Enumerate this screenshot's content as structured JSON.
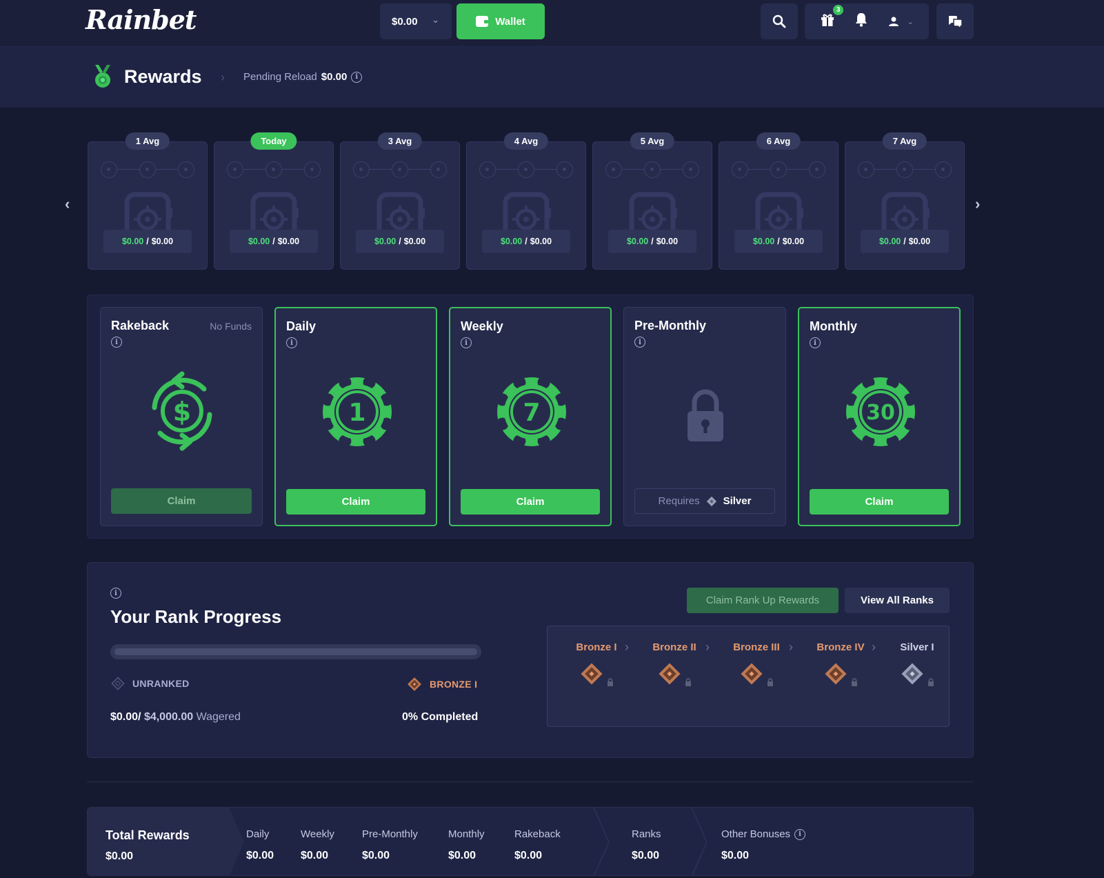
{
  "topbar": {
    "logo": "Rainbet",
    "balance": "$0.00",
    "wallet_label": "Wallet",
    "gift_badge": "3"
  },
  "header": {
    "title": "Rewards",
    "pending_label": "Pending Reload",
    "pending_value": "$0.00"
  },
  "days": [
    {
      "label": "1 Avg",
      "today": false,
      "earned": "$0.00",
      "total": "$0.00"
    },
    {
      "label": "Today",
      "today": true,
      "earned": "$0.00",
      "total": "$0.00"
    },
    {
      "label": "3 Avg",
      "today": false,
      "earned": "$0.00",
      "total": "$0.00"
    },
    {
      "label": "4 Avg",
      "today": false,
      "earned": "$0.00",
      "total": "$0.00"
    },
    {
      "label": "5 Avg",
      "today": false,
      "earned": "$0.00",
      "total": "$0.00"
    },
    {
      "label": "6 Avg",
      "today": false,
      "earned": "$0.00",
      "total": "$0.00"
    },
    {
      "label": "7 Avg",
      "today": false,
      "earned": "$0.00",
      "total": "$0.00"
    }
  ],
  "reward_cards": [
    {
      "title": "Rakeback",
      "subtitle": "No Funds",
      "button": "Claim",
      "chip": ""
    },
    {
      "title": "Daily",
      "subtitle": "",
      "button": "Claim",
      "chip": "1"
    },
    {
      "title": "Weekly",
      "subtitle": "",
      "button": "Claim",
      "chip": "7"
    },
    {
      "title": "Pre-Monthly",
      "subtitle": "",
      "requires_label": "Requires",
      "requires_rank": "Silver",
      "chip": ""
    },
    {
      "title": "Monthly",
      "subtitle": "",
      "button": "Claim",
      "chip": "30"
    }
  ],
  "rank_progress": {
    "title": "Your Rank Progress",
    "progress_fraction": 0,
    "current_rank": "UNRANKED",
    "next_rank": "BRONZE I",
    "wagered": "$0.00/",
    "wager_target": "$4,000.00",
    "wager_suffix": "Wagered",
    "completed": "0% Completed",
    "claim_button": "Claim Rank Up Rewards",
    "view_button": "View All Ranks",
    "ranks": [
      "Bronze I",
      "Bronze II",
      "Bronze III",
      "Bronze IV",
      "Silver I"
    ]
  },
  "totals": {
    "main_label": "Total Rewards",
    "main_value": "$0.00",
    "items": [
      {
        "label": "Daily",
        "value": "$0.00"
      },
      {
        "label": "Weekly",
        "value": "$0.00"
      },
      {
        "label": "Pre-Monthly",
        "value": "$0.00"
      },
      {
        "label": "Monthly",
        "value": "$0.00"
      },
      {
        "label": "Rakeback",
        "value": "$0.00"
      },
      {
        "label": "Ranks",
        "value": "$0.00"
      },
      {
        "label": "Other Bonuses",
        "value": "$0.00"
      }
    ]
  },
  "colors": {
    "accent_green": "#3bc25a",
    "bronze": "#e59a6f",
    "background": "#161a31"
  }
}
